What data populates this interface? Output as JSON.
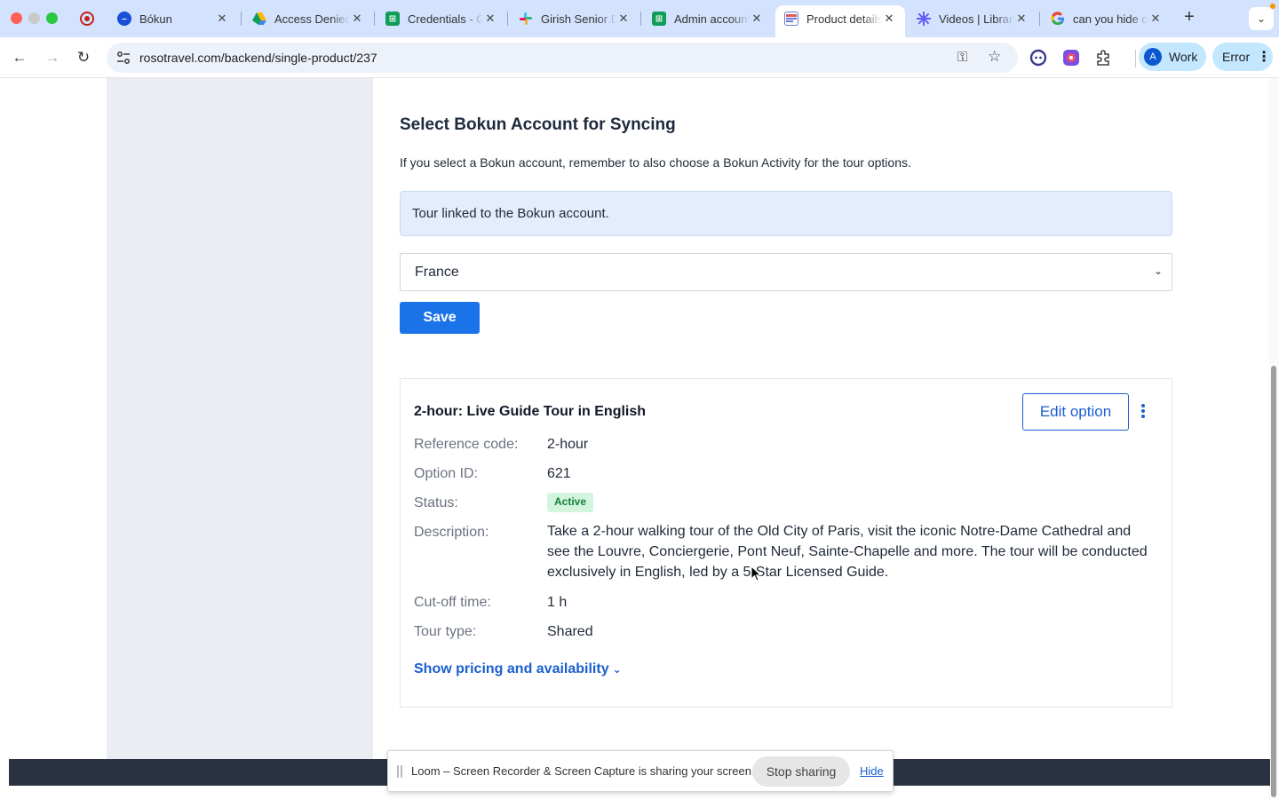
{
  "browser": {
    "tabs": [
      {
        "title": "Bókun",
        "favicon": "bokun-favicon",
        "color": "#1a4fd8"
      },
      {
        "title": "Access Denied",
        "favicon": "google-drive-favicon",
        "color": "#0f9d58"
      },
      {
        "title": "Credentials - Google Sheets",
        "favicon": "google-sheets-favicon",
        "color": "#0f9d58"
      },
      {
        "title": "Girish Senior Developer",
        "favicon": "slack-favicon",
        "color": "#e01e5a"
      },
      {
        "title": "Admin account",
        "favicon": "google-sheets-favicon",
        "color": "#0f9d58"
      },
      {
        "title": "Product details",
        "favicon": "roso-favicon",
        "color": "#6b7bd6"
      },
      {
        "title": "Videos | Library",
        "favicon": "loom-favicon",
        "color": "#625df5"
      },
      {
        "title": "can you hide chrome",
        "favicon": "google-favicon",
        "color": "#4285f4"
      }
    ],
    "url": "rosotravel.com/backend/single-product/237",
    "profile": {
      "initial": "A",
      "label": "Work"
    },
    "error_label": "Error"
  },
  "sync": {
    "title": "Select Bokun Account for Syncing",
    "hint": "If you select a Bokun account, remember to also choose a Bokun Activity for the tour options.",
    "alert": "Tour linked to the Bokun account.",
    "selected_account": "France",
    "save_label": "Save"
  },
  "option": {
    "title": "2-hour: Live Guide Tour in English",
    "edit_label": "Edit option",
    "rows": {
      "reference_label": "Reference code:",
      "reference_value": "2-hour",
      "id_label": "Option ID:",
      "id_value": "621",
      "status_label": "Status:",
      "status_value": "Active",
      "description_label": "Description:",
      "description_value": "Take a 2-hour walking tour of the Old City of Paris, visit the iconic Notre-Dame Cathedral and see the Louvre, Conciergerie, Pont Neuf, Sainte-Chapelle and more. The tour will be conducted exclusively in English, led by a 5-Star Licensed Guide.",
      "cutoff_label": "Cut-off time:",
      "cutoff_value": "1 h",
      "tourtype_label": "Tour type:",
      "tourtype_value": "Shared"
    },
    "pricing_link": "Show pricing and availability"
  },
  "loom": {
    "message": "Loom – Screen Recorder & Screen Capture is sharing your screen.",
    "stop_label": "Stop sharing",
    "hide_label": "Hide"
  },
  "colors": {
    "accent": "#1a73e8",
    "link": "#1a5fd0",
    "status_active_bg": "#d3f5dd",
    "status_active_text": "#16803c"
  }
}
